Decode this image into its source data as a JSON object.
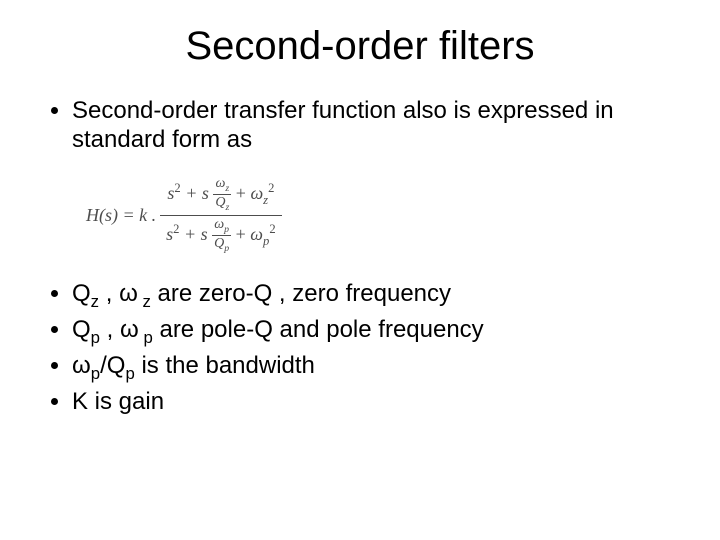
{
  "title": "Second-order filters",
  "intro": "Second-order transfer function also is expressed in standard form as",
  "equation": {
    "lhs": "H(s) = k .",
    "num_lead": "s",
    "num_exp": "2",
    "plus": " + s",
    "omega": "ω",
    "z_sub": "z",
    "p_sub": "p",
    "Q": "Q",
    "sq": "2"
  },
  "bullets": {
    "b1_a": "Q",
    "b1_b": " , ",
    "b1_c": " are zero-Q , zero frequency",
    "b2_a": " Q",
    "b2_b": " , ",
    "b2_c": " are pole-Q and pole frequency",
    "b3_a": "/Q",
    "b3_b": " is the bandwidth",
    "b4": "K is gain",
    "z": "z",
    "p": "p",
    "omega": "ω"
  }
}
